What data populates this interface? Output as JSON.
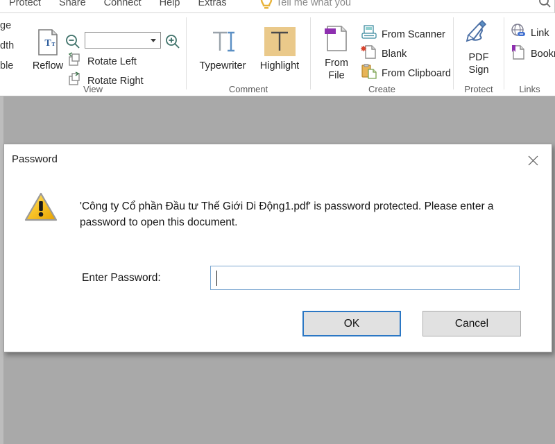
{
  "ribbon": {
    "tabs": [
      {
        "label": "Protect"
      },
      {
        "label": "Share"
      },
      {
        "label": "Connect"
      },
      {
        "label": "Help"
      },
      {
        "label": "Extras"
      }
    ],
    "tell_me": "Tell me what you",
    "bulb_icon": "lightbulb-icon",
    "search_icon": "search-icon",
    "groups": [
      {
        "name": "View",
        "label": "View",
        "truncated_labels": [
          "ge",
          "dth",
          "ble"
        ],
        "reflow": {
          "label": "Reflow",
          "icon": "reflow-text-icon"
        },
        "zoom_out_icon": "zoom-out-icon",
        "zoom_in_icon": "zoom-in-icon",
        "zoom_value": "",
        "rotate_left": {
          "label": "Rotate Left",
          "icon": "rotate-left-icon"
        },
        "rotate_right": {
          "label": "Rotate Right",
          "icon": "rotate-right-icon"
        }
      },
      {
        "name": "Comment",
        "label": "Comment",
        "typewriter": {
          "label": "Typewriter",
          "icon": "typewriter-icon"
        },
        "highlight": {
          "label": "Highlight",
          "icon": "highlight-icon",
          "highlight_color": "#eac98a"
        }
      },
      {
        "name": "Create",
        "label": "Create",
        "from_file": {
          "label_line1": "From",
          "label_line2": "File",
          "icon": "from-file-icon"
        },
        "from_scanner": {
          "label": "From Scanner",
          "icon": "scanner-icon"
        },
        "blank": {
          "label": "Blank",
          "icon": "blank-page-icon"
        },
        "from_clipboard": {
          "label": "From Clipboard",
          "icon": "clipboard-icon"
        }
      },
      {
        "name": "Protect",
        "label": "Protect",
        "pdf_sign": {
          "label_line1": "PDF",
          "label_line2": "Sign",
          "icon": "pdf-sign-pen-icon"
        }
      },
      {
        "name": "Links",
        "label": "Links",
        "link": {
          "label": "Link",
          "icon": "globe-link-icon"
        },
        "bookmark": {
          "label": "Bookm",
          "icon": "bookmark-icon"
        }
      }
    ]
  },
  "dialog": {
    "title": "Password",
    "close_icon": "close-icon",
    "warning_icon": "warning-triangle-icon",
    "message": "'Công ty Cổ phần Đầu tư Thế Giới Di Động1.pdf' is password protected. Please enter a password to open this document.",
    "password_label": "Enter Password:",
    "password_value": "",
    "password_placeholder": "",
    "ok_label": "OK",
    "cancel_label": "Cancel",
    "accent_color": "#2b77c4"
  }
}
